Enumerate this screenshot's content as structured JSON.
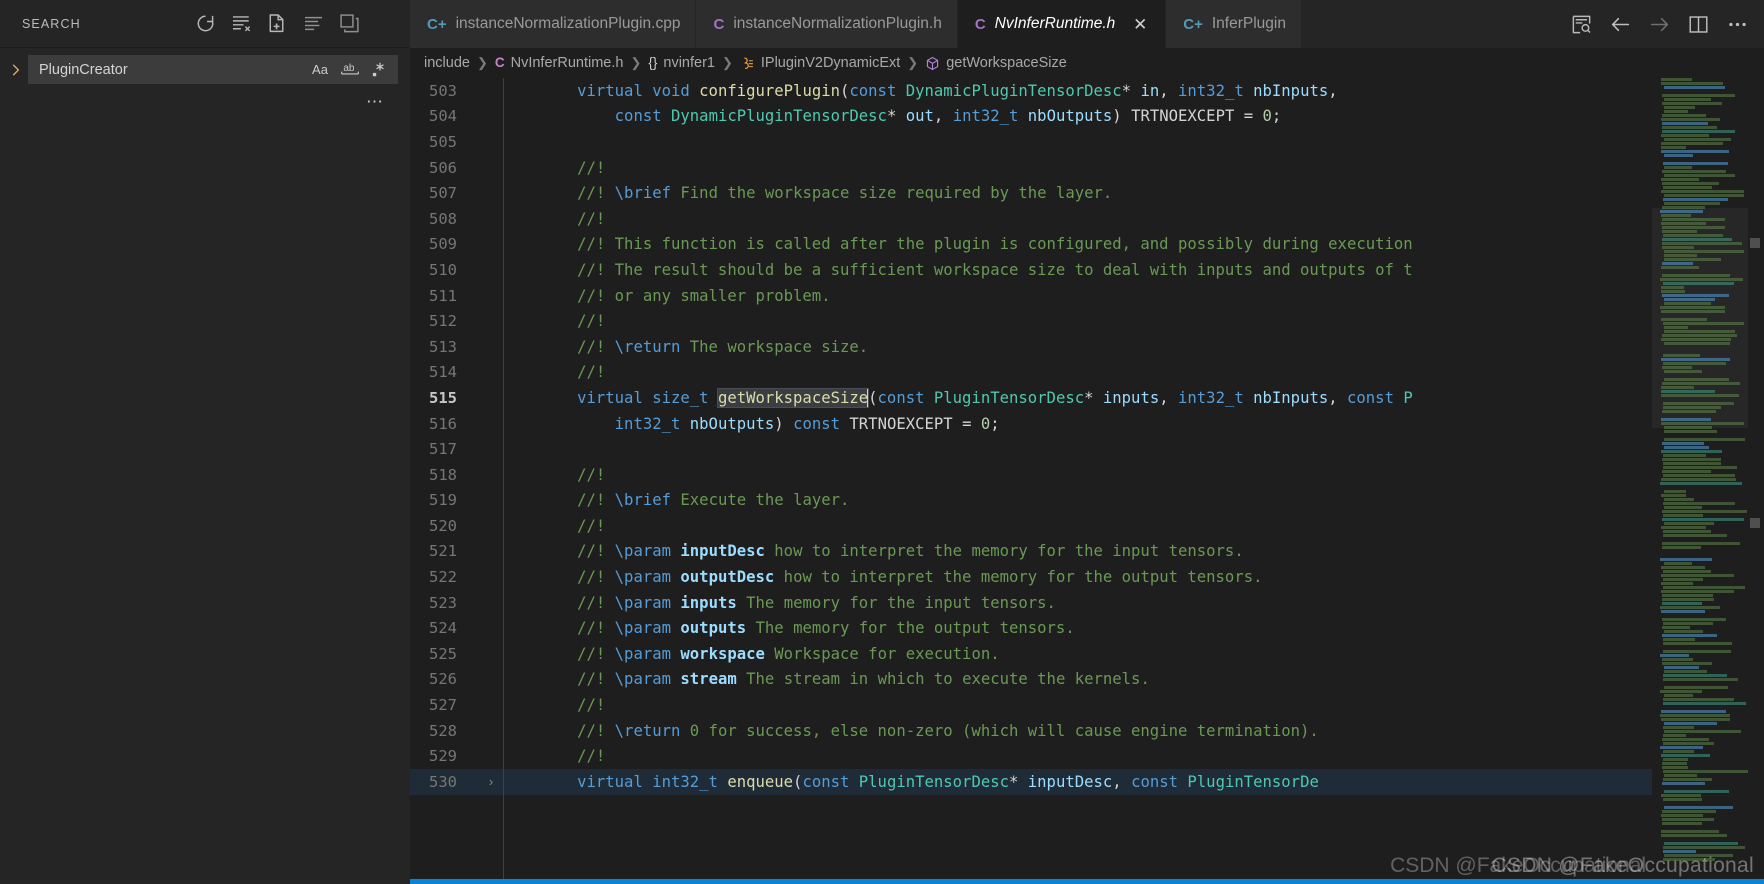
{
  "sidebar": {
    "title": "SEARCH",
    "actions": [
      {
        "name": "refresh-icon",
        "tip": "Refresh"
      },
      {
        "name": "clear-search-results-icon",
        "tip": "Clear Search Results"
      },
      {
        "name": "open-new-search-editor-icon",
        "tip": "Open New Search Editor"
      },
      {
        "name": "view-as-list-icon",
        "tip": "View as List"
      },
      {
        "name": "collapse-all-icon",
        "tip": "Collapse All"
      }
    ],
    "search": {
      "value": "PluginCreator",
      "placeholder": "Search",
      "options": [
        {
          "name": "match-case-icon",
          "glyph": "Aa"
        },
        {
          "name": "match-whole-word-icon",
          "glyph": "ab"
        },
        {
          "name": "use-regex-icon",
          "glyph": "✳"
        }
      ]
    },
    "more_label": "⋯"
  },
  "tabs": [
    {
      "label": "instanceNormalizationPlugin.cpp",
      "icon": "C+",
      "icon_kind": "cpp",
      "active": false,
      "closable": false,
      "clipped": false
    },
    {
      "label": "instanceNormalizationPlugin.h",
      "icon": "C",
      "icon_kind": "h",
      "active": false,
      "closable": false,
      "clipped": false
    },
    {
      "label": "NvInferRuntime.h",
      "icon": "C",
      "icon_kind": "h",
      "active": true,
      "closable": true,
      "clipped": false
    },
    {
      "label": "InferPlugin",
      "icon": "C+",
      "icon_kind": "cpp",
      "active": false,
      "closable": false,
      "clipped": true
    }
  ],
  "editor_actions": [
    {
      "name": "open-changes-icon"
    },
    {
      "name": "go-back-icon"
    },
    {
      "name": "go-forward-icon"
    },
    {
      "name": "split-editor-icon"
    },
    {
      "name": "more-actions-icon"
    }
  ],
  "breadcrumb": [
    {
      "label": "include",
      "icon": ""
    },
    {
      "label": "NvInferRuntime.h",
      "icon": "C",
      "icon_kind": "cls"
    },
    {
      "label": "nvinfer1",
      "icon": "{}",
      "icon_kind": "ns"
    },
    {
      "label": "IPluginV2DynamicExt",
      "icon": "⚘",
      "icon_kind": "iface"
    },
    {
      "label": "getWorkspaceSize",
      "icon": "⬡",
      "icon_kind": "method"
    }
  ],
  "code": {
    "first_line": 503,
    "current_line": 515,
    "selected_word": "getWorkspaceSize",
    "lines": [
      {
        "n": 503,
        "tokens": [
          {
            "t": "        ",
            "c": "pl"
          },
          {
            "t": "virtual ",
            "c": "kw"
          },
          {
            "t": "void ",
            "c": "kw"
          },
          {
            "t": "configurePlugin",
            "c": "fn"
          },
          {
            "t": "(",
            "c": "pl"
          },
          {
            "t": "const ",
            "c": "kw"
          },
          {
            "t": "DynamicPluginTensorDesc",
            "c": "type"
          },
          {
            "t": "* ",
            "c": "pl"
          },
          {
            "t": "in",
            "c": "var"
          },
          {
            "t": ", ",
            "c": "pl"
          },
          {
            "t": "int32_t ",
            "c": "kw"
          },
          {
            "t": "nbInputs",
            "c": "var"
          },
          {
            "t": ",",
            "c": "pl"
          }
        ]
      },
      {
        "n": 504,
        "tokens": [
          {
            "t": "            ",
            "c": "pl"
          },
          {
            "t": "const ",
            "c": "kw"
          },
          {
            "t": "DynamicPluginTensorDesc",
            "c": "type"
          },
          {
            "t": "* ",
            "c": "pl"
          },
          {
            "t": "out",
            "c": "var"
          },
          {
            "t": ", ",
            "c": "pl"
          },
          {
            "t": "int32_t ",
            "c": "kw"
          },
          {
            "t": "nbOutputs",
            "c": "var"
          },
          {
            "t": ") ",
            "c": "pl"
          },
          {
            "t": "TRTNOEXCEPT ",
            "c": "mac"
          },
          {
            "t": "= ",
            "c": "pl"
          },
          {
            "t": "0",
            "c": "num"
          },
          {
            "t": ";",
            "c": "pl"
          }
        ]
      },
      {
        "n": 505,
        "tokens": []
      },
      {
        "n": 506,
        "tokens": [
          {
            "t": "        //!",
            "c": "cmt"
          }
        ]
      },
      {
        "n": 507,
        "tokens": [
          {
            "t": "        //! ",
            "c": "cmt"
          },
          {
            "t": "\\brief",
            "c": "doc"
          },
          {
            "t": " Find the workspace size required by the layer.",
            "c": "cmt"
          }
        ]
      },
      {
        "n": 508,
        "tokens": [
          {
            "t": "        //!",
            "c": "cmt"
          }
        ]
      },
      {
        "n": 509,
        "tokens": [
          {
            "t": "        //! This function is called after the plugin is configured, and possibly during execution",
            "c": "cmt"
          }
        ]
      },
      {
        "n": 510,
        "tokens": [
          {
            "t": "        //! The result should be a sufficient workspace size to deal with inputs and outputs of t",
            "c": "cmt"
          }
        ]
      },
      {
        "n": 511,
        "tokens": [
          {
            "t": "        //! or any smaller problem.",
            "c": "cmt"
          }
        ]
      },
      {
        "n": 512,
        "tokens": [
          {
            "t": "        //!",
            "c": "cmt"
          }
        ]
      },
      {
        "n": 513,
        "tokens": [
          {
            "t": "        //! ",
            "c": "cmt"
          },
          {
            "t": "\\return",
            "c": "doc"
          },
          {
            "t": " The workspace size.",
            "c": "cmt"
          }
        ]
      },
      {
        "n": 514,
        "tokens": [
          {
            "t": "        //!",
            "c": "cmt"
          }
        ]
      },
      {
        "n": 515,
        "tokens": [
          {
            "t": "        ",
            "c": "pl"
          },
          {
            "t": "virtual ",
            "c": "kw"
          },
          {
            "t": "size_t ",
            "c": "kw"
          },
          {
            "t": "getWorkspaceSize",
            "c": "fn",
            "sel": true
          },
          {
            "t": "(",
            "c": "pl"
          },
          {
            "t": "const ",
            "c": "kw"
          },
          {
            "t": "PluginTensorDesc",
            "c": "type"
          },
          {
            "t": "* ",
            "c": "pl"
          },
          {
            "t": "inputs",
            "c": "var"
          },
          {
            "t": ", ",
            "c": "pl"
          },
          {
            "t": "int32_t ",
            "c": "kw"
          },
          {
            "t": "nbInputs",
            "c": "var"
          },
          {
            "t": ", ",
            "c": "pl"
          },
          {
            "t": "const ",
            "c": "kw"
          },
          {
            "t": "P",
            "c": "type"
          }
        ]
      },
      {
        "n": 516,
        "tokens": [
          {
            "t": "            ",
            "c": "pl"
          },
          {
            "t": "int32_t ",
            "c": "kw"
          },
          {
            "t": "nbOutputs",
            "c": "var"
          },
          {
            "t": ") ",
            "c": "pl"
          },
          {
            "t": "const ",
            "c": "kw"
          },
          {
            "t": "TRTNOEXCEPT ",
            "c": "mac"
          },
          {
            "t": "= ",
            "c": "pl"
          },
          {
            "t": "0",
            "c": "num"
          },
          {
            "t": ";",
            "c": "pl"
          }
        ]
      },
      {
        "n": 517,
        "tokens": []
      },
      {
        "n": 518,
        "tokens": [
          {
            "t": "        //!",
            "c": "cmt"
          }
        ]
      },
      {
        "n": 519,
        "tokens": [
          {
            "t": "        //! ",
            "c": "cmt"
          },
          {
            "t": "\\brief",
            "c": "doc"
          },
          {
            "t": " Execute the layer.",
            "c": "cmt"
          }
        ]
      },
      {
        "n": 520,
        "tokens": [
          {
            "t": "        //!",
            "c": "cmt"
          }
        ]
      },
      {
        "n": 521,
        "tokens": [
          {
            "t": "        //! ",
            "c": "cmt"
          },
          {
            "t": "\\param",
            "c": "doc"
          },
          {
            "t": " ",
            "c": "cmt"
          },
          {
            "t": "inputDesc",
            "c": "docb"
          },
          {
            "t": " how to interpret the memory for the input tensors.",
            "c": "cmt"
          }
        ]
      },
      {
        "n": 522,
        "tokens": [
          {
            "t": "        //! ",
            "c": "cmt"
          },
          {
            "t": "\\param",
            "c": "doc"
          },
          {
            "t": " ",
            "c": "cmt"
          },
          {
            "t": "outputDesc",
            "c": "docb"
          },
          {
            "t": " how to interpret the memory for the output tensors.",
            "c": "cmt"
          }
        ]
      },
      {
        "n": 523,
        "tokens": [
          {
            "t": "        //! ",
            "c": "cmt"
          },
          {
            "t": "\\param",
            "c": "doc"
          },
          {
            "t": " ",
            "c": "cmt"
          },
          {
            "t": "inputs",
            "c": "docb"
          },
          {
            "t": " The memory for the input tensors.",
            "c": "cmt"
          }
        ]
      },
      {
        "n": 524,
        "tokens": [
          {
            "t": "        //! ",
            "c": "cmt"
          },
          {
            "t": "\\param",
            "c": "doc"
          },
          {
            "t": " ",
            "c": "cmt"
          },
          {
            "t": "outputs",
            "c": "docb"
          },
          {
            "t": " The memory for the output tensors.",
            "c": "cmt"
          }
        ]
      },
      {
        "n": 525,
        "tokens": [
          {
            "t": "        //! ",
            "c": "cmt"
          },
          {
            "t": "\\param",
            "c": "doc"
          },
          {
            "t": " ",
            "c": "cmt"
          },
          {
            "t": "workspace",
            "c": "docb"
          },
          {
            "t": " Workspace for execution.",
            "c": "cmt"
          }
        ]
      },
      {
        "n": 526,
        "tokens": [
          {
            "t": "        //! ",
            "c": "cmt"
          },
          {
            "t": "\\param",
            "c": "doc"
          },
          {
            "t": " ",
            "c": "cmt"
          },
          {
            "t": "stream",
            "c": "docb"
          },
          {
            "t": " The stream in which to execute the kernels.",
            "c": "cmt"
          }
        ]
      },
      {
        "n": 527,
        "tokens": [
          {
            "t": "        //!",
            "c": "cmt"
          }
        ]
      },
      {
        "n": 528,
        "tokens": [
          {
            "t": "        //! ",
            "c": "cmt"
          },
          {
            "t": "\\return",
            "c": "doc"
          },
          {
            "t": " 0 for success, else non-zero (which will cause engine termination).",
            "c": "cmt"
          }
        ]
      },
      {
        "n": 529,
        "tokens": [
          {
            "t": "        //!",
            "c": "cmt"
          }
        ]
      },
      {
        "n": 530,
        "tokens": [
          {
            "t": "        ",
            "c": "pl"
          },
          {
            "t": "virtual ",
            "c": "kw"
          },
          {
            "t": "int32_t ",
            "c": "kw"
          },
          {
            "t": "enqueue",
            "c": "fn"
          },
          {
            "t": "(",
            "c": "pl"
          },
          {
            "t": "const ",
            "c": "kw"
          },
          {
            "t": "PluginTensorDesc",
            "c": "type"
          },
          {
            "t": "* ",
            "c": "pl"
          },
          {
            "t": "inputDesc",
            "c": "var"
          },
          {
            "t": ", ",
            "c": "pl"
          },
          {
            "t": "const ",
            "c": "kw"
          },
          {
            "t": "PluginTensorDe",
            "c": "type"
          }
        ],
        "fold": "›",
        "sel": true
      }
    ]
  },
  "watermark": {
    "text": "CSDN @FakeOccupational",
    "overlap": "CSDN @FakeOccupational"
  },
  "colors": {
    "editor_bg": "#1e1e1e",
    "sidebar_bg": "#252526",
    "tab_inactive_bg": "#2d2d2d",
    "accent": "#0a84d8",
    "keyword": "#569cd6",
    "type": "#4ec9b0",
    "function": "#dcdcaa",
    "comment": "#6a9955",
    "variable": "#9cdcfe",
    "number": "#b5cea8"
  }
}
